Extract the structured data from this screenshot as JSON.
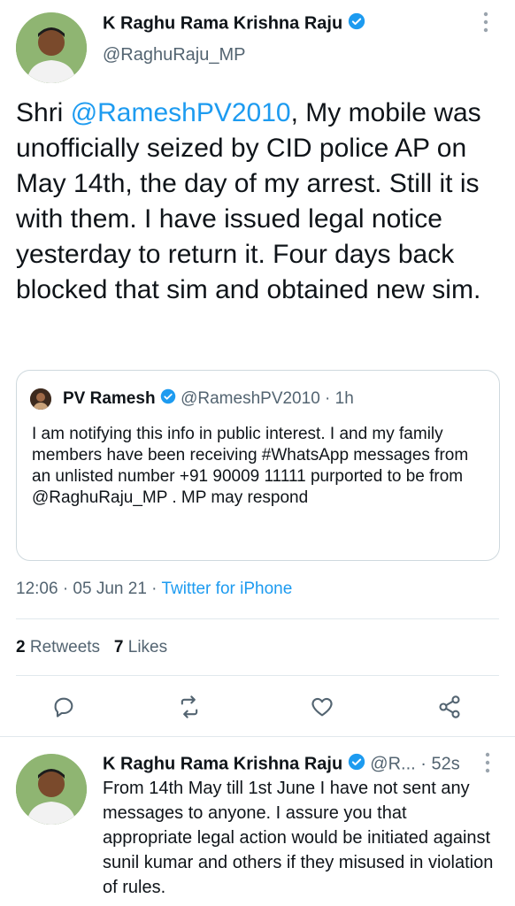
{
  "main_tweet": {
    "author_name": "K Raghu Rama Krishna Raju",
    "author_handle": "@RaghuRaju_MP",
    "text_prefix": "Shri ",
    "mention": "@RameshPV2010",
    "text_body": ", My mobile was unofficially seized by CID police AP on May 14th, the day of my arrest. Still it is with them. I have issued legal notice yesterday to return it. Four days back blocked that sim and obtained new sim."
  },
  "quoted_tweet": {
    "author_name": "PV Ramesh",
    "author_handle": "@RameshPV2010",
    "time": "· 1h",
    "text": "I am notifying this info in public interest. I and my family members have been receiving #WhatsApp messages from an unlisted number +91 90009 11111 purported to be from @RaghuRaju_MP . MP may respond"
  },
  "meta": {
    "timestamp": "12:06 · 05 Jun 21 · ",
    "source": "Twitter for iPhone"
  },
  "stats": {
    "retweets_count": "2",
    "retweets_label": "Retweets",
    "likes_count": "7",
    "likes_label": "Likes"
  },
  "actions": [
    "reply-icon",
    "retweet-icon",
    "like-icon",
    "share-icon"
  ],
  "reply_tweet": {
    "author_name": "K Raghu Rama Krishna Raju",
    "author_handle": "@R...",
    "time": "· 52s",
    "text": "From 14th May till 1st June I have not sent any messages to anyone. I assure you that appropriate legal action would be initiated against sunil kumar and others if they misused in violation of rules."
  },
  "colors": {
    "accent": "#1d9bf0",
    "text": "#0f1419",
    "secondary": "#536471",
    "border": "#cfd9de"
  }
}
